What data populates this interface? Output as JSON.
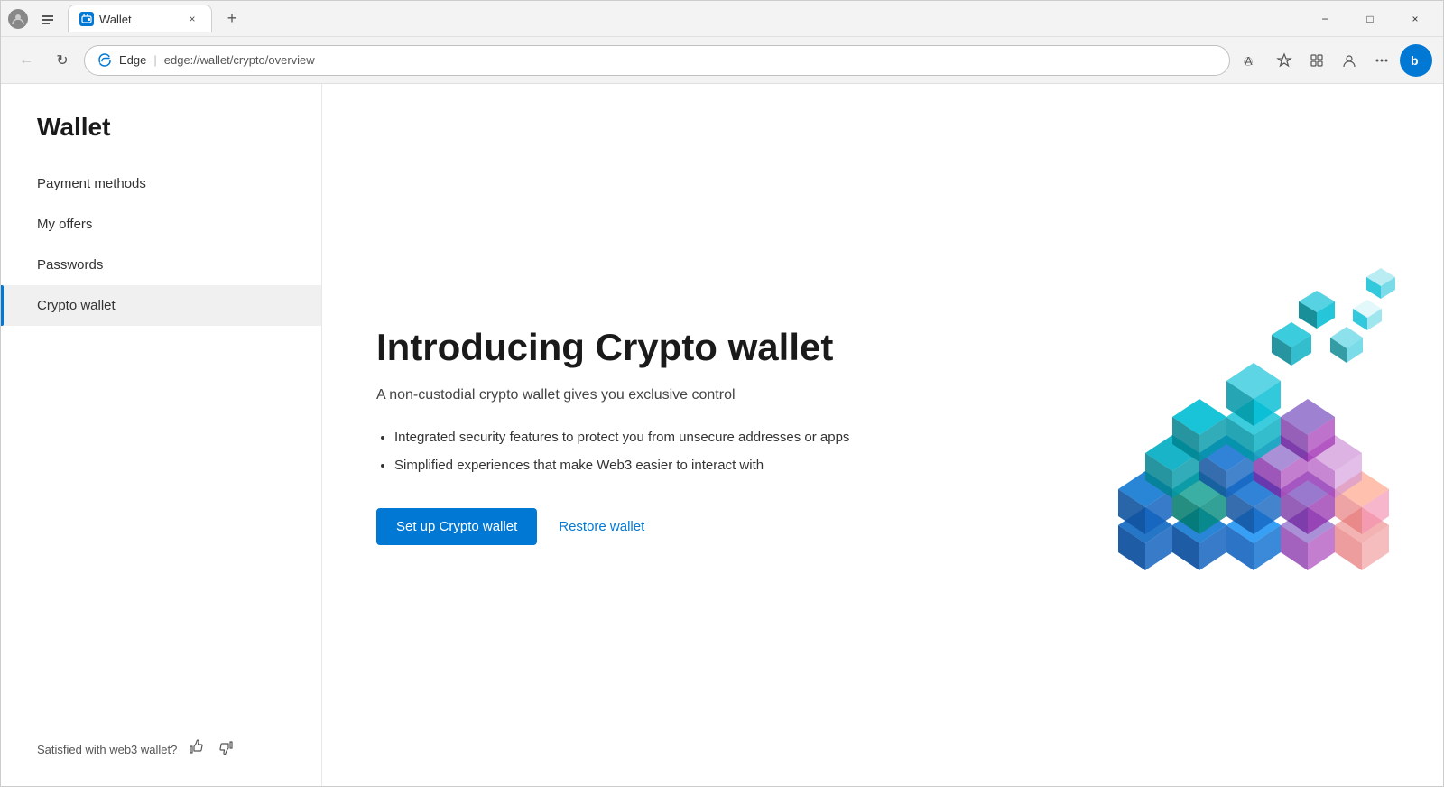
{
  "browser": {
    "tab": {
      "icon": "W",
      "title": "Wallet",
      "close_label": "×"
    },
    "new_tab_label": "+",
    "window_controls": {
      "minimize": "−",
      "maximize": "□",
      "close": "×"
    },
    "address_bar": {
      "brand": "Edge",
      "separator": "|",
      "url": "edge://wallet/crypto/overview"
    },
    "toolbar": {
      "read_aloud": "A",
      "favorites": "☆",
      "collections": "□",
      "profile": "👤",
      "more": "···",
      "bing": "b"
    }
  },
  "sidebar": {
    "title": "Wallet",
    "nav_items": [
      {
        "id": "payment-methods",
        "label": "Payment methods",
        "active": false
      },
      {
        "id": "my-offers",
        "label": "My offers",
        "active": false
      },
      {
        "id": "passwords",
        "label": "Passwords",
        "active": false
      },
      {
        "id": "crypto-wallet",
        "label": "Crypto wallet",
        "active": true
      }
    ],
    "footer": {
      "satisfaction_label": "Satisfied with web3 wallet?",
      "thumbs_up": "👍",
      "thumbs_down": "👎"
    }
  },
  "main": {
    "heading": "Introducing Crypto wallet",
    "subtitle": "A non-custodial crypto wallet gives you exclusive control",
    "features": [
      "Integrated security features to protect you from unsecure addresses or apps",
      "Simplified experiences that make Web3 easier to interact with"
    ],
    "setup_button": "Set up Crypto wallet",
    "restore_link": "Restore wallet"
  }
}
